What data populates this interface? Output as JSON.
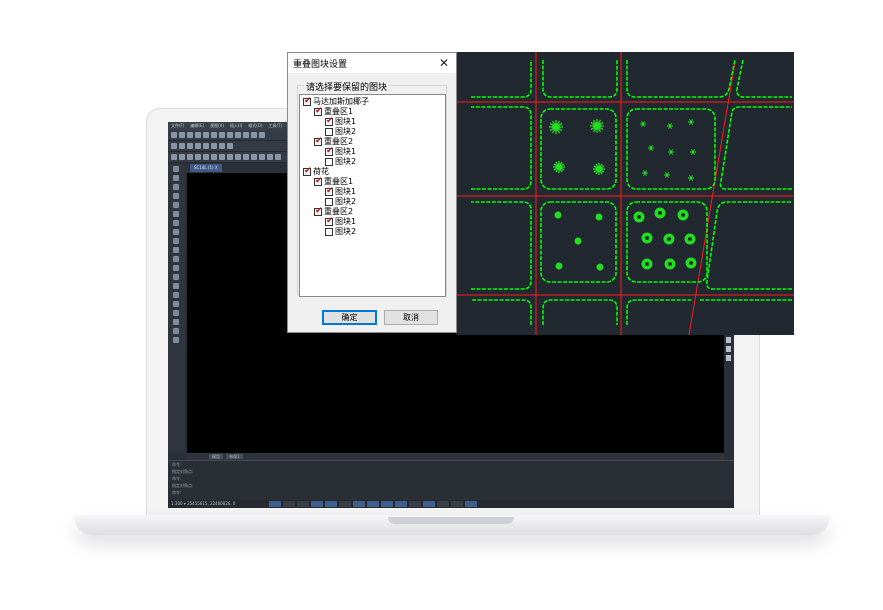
{
  "app": {
    "menu": [
      "文件(F)",
      "编辑(E)",
      "视图(V)",
      "插入(I)",
      "格式(O)",
      "工具(T)",
      "绘图(D)",
      "标注(N)",
      "修改(M)"
    ],
    "document_tab": "SC14L (1) X",
    "layout_tabs": [
      "模型",
      "布局1"
    ],
    "command_lines": [
      "命令:",
      "指定对角点:",
      "命令:",
      "指定对角点:",
      "命令:"
    ],
    "coordinates": "1:300 ▾   25455615, 22400826, 0"
  },
  "dialog": {
    "title": "重叠图块设置",
    "close_glyph": "✕",
    "group_label": "请选择要保留的图块",
    "tree": [
      {
        "label": "马达加斯加椰子",
        "level": 0,
        "checked": "full"
      },
      {
        "label": "重叠区1",
        "level": 1,
        "checked": "full"
      },
      {
        "label": "图块1",
        "level": 2,
        "checked": "tick"
      },
      {
        "label": "图块2",
        "level": 2,
        "checked": "none"
      },
      {
        "label": "重叠区2",
        "level": 1,
        "checked": "full"
      },
      {
        "label": "图块1",
        "level": 2,
        "checked": "tick"
      },
      {
        "label": "图块2",
        "level": 2,
        "checked": "none"
      },
      {
        "label": "荷花",
        "level": 0,
        "checked": "full"
      },
      {
        "label": "重叠区1",
        "level": 1,
        "checked": "full"
      },
      {
        "label": "图块1",
        "level": 2,
        "checked": "tick"
      },
      {
        "label": "图块2",
        "level": 2,
        "checked": "none"
      },
      {
        "label": "重叠区2",
        "level": 1,
        "checked": "full"
      },
      {
        "label": "图块1",
        "level": 2,
        "checked": "tick"
      },
      {
        "label": "图块2",
        "level": 2,
        "checked": "none"
      }
    ],
    "ok_label": "确定",
    "cancel_label": "取消"
  },
  "colors": {
    "road_edge": "#00ff00",
    "center_line": "#ff1a1a",
    "plant": "#22dd22",
    "preview_bg": "#212830",
    "check_mark": "#c0121a"
  }
}
